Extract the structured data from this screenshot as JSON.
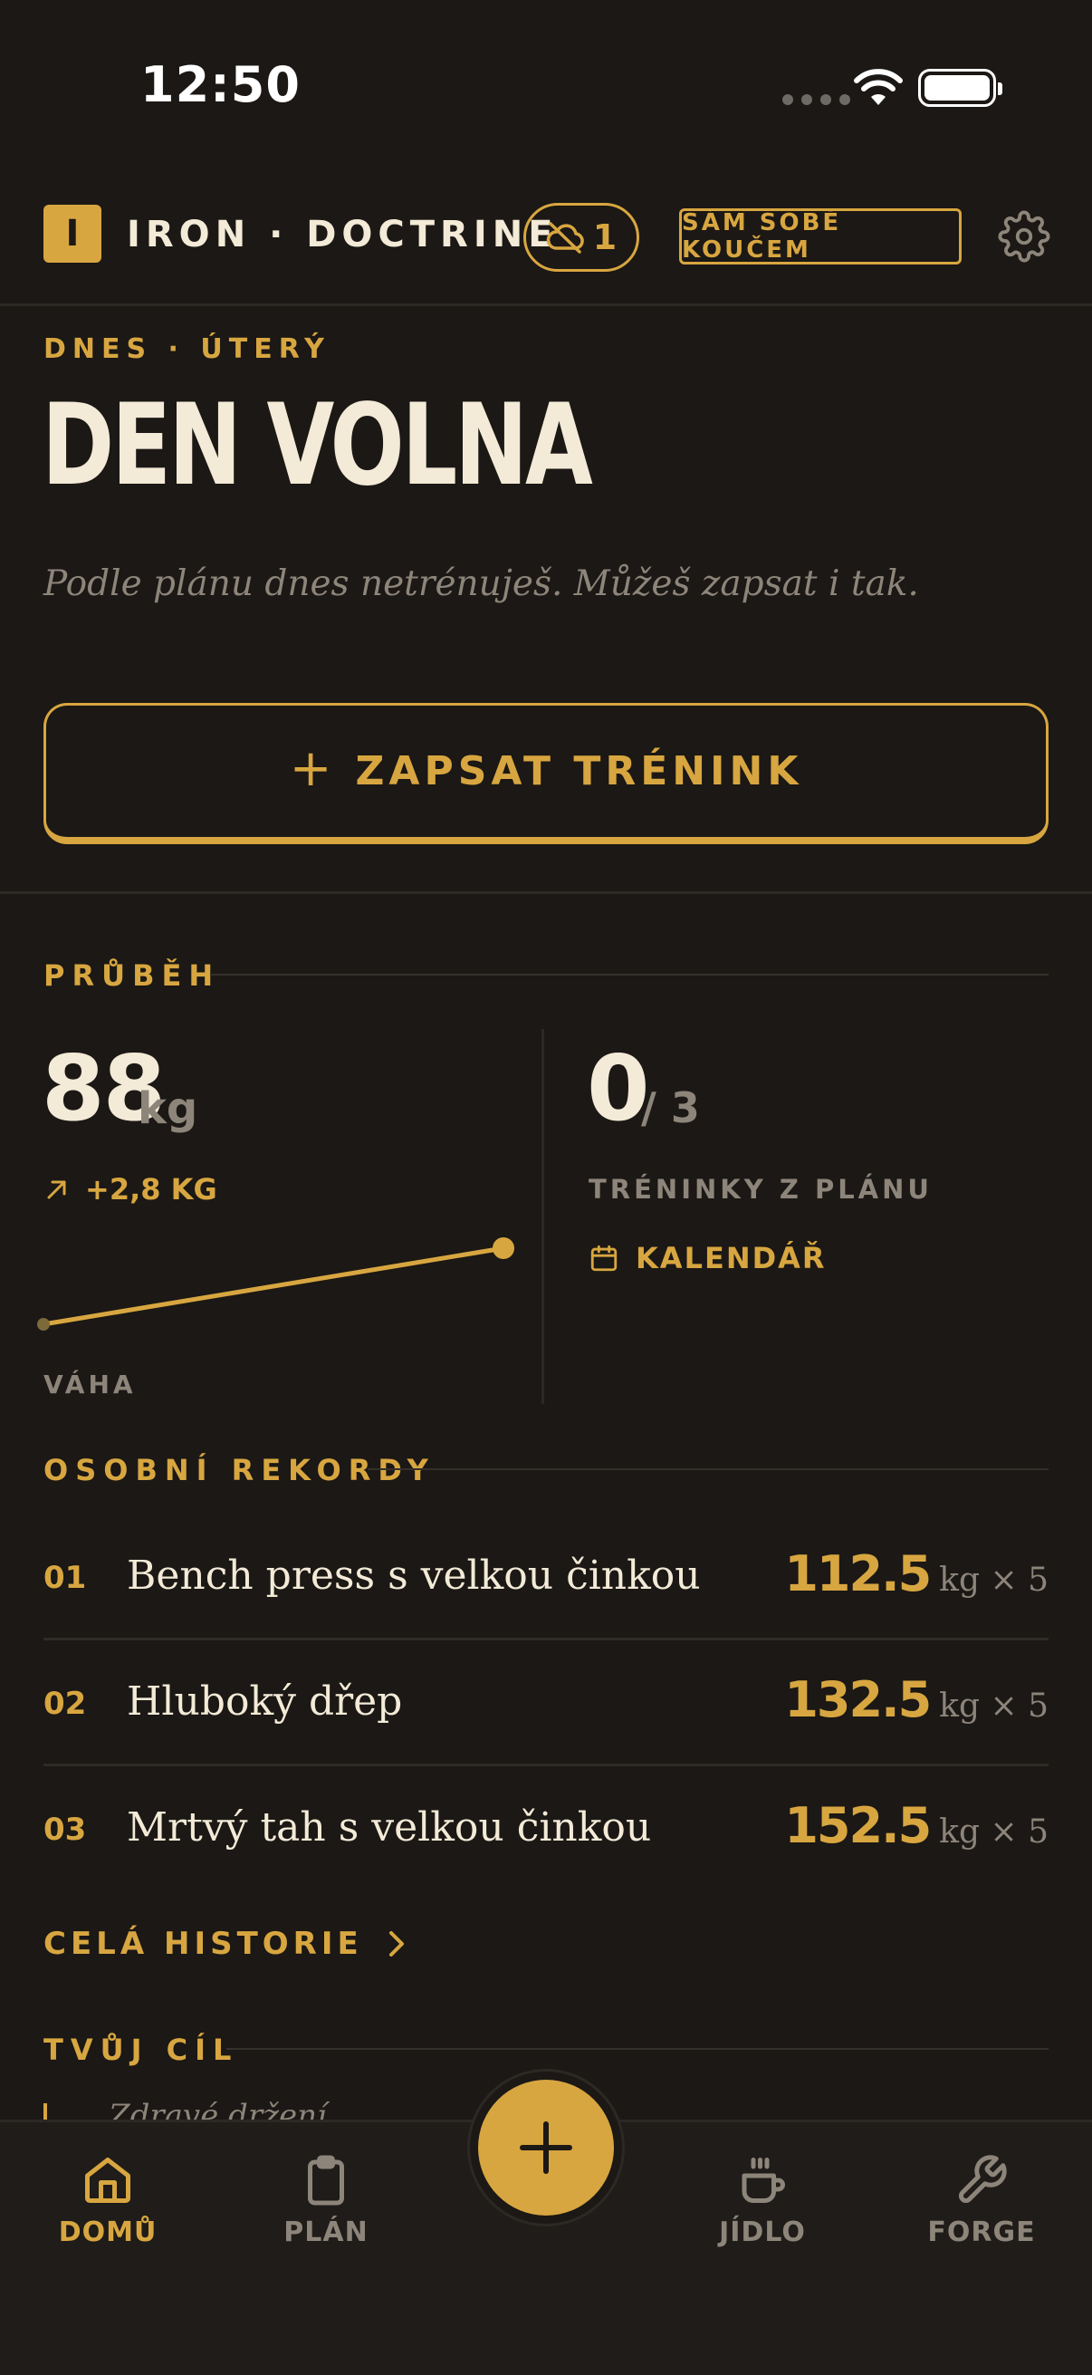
{
  "status_bar": {
    "time": "12:50"
  },
  "header": {
    "logo_letter": "I",
    "app_name": "IRON · DOCTRINE",
    "offline_count": "1",
    "coach_mode": "SÁM SOBĚ KOUČEM"
  },
  "today": {
    "label": "DNES · ÚTERÝ",
    "title": "DEN VOLNA",
    "subtitle": "Podle plánu dnes netrénuješ. Můžeš zapsat i tak.",
    "log_button": "ZAPSAT TRÉNINK"
  },
  "progress": {
    "heading": "PRŮBĚH",
    "weight": {
      "value": "88",
      "unit": "kg",
      "delta": "+2,8 KG",
      "label": "VÁHA"
    },
    "plan": {
      "done": "0",
      "total": "/ 3",
      "label": "TRÉNINKY Z PLÁNU",
      "calendar_link": "KALENDÁŘ"
    }
  },
  "records": {
    "heading": "OSOBNÍ REKORDY",
    "items": [
      {
        "num": "01",
        "name": "Bench press s velkou činkou",
        "weight": "112.5",
        "unit": "kg × 5"
      },
      {
        "num": "02",
        "name": "Hluboký dřep",
        "weight": "132.5",
        "unit": "kg × 5"
      },
      {
        "num": "03",
        "name": "Mrtvý tah s velkou činkou",
        "weight": "152.5",
        "unit": "kg × 5"
      }
    ],
    "history_link": "CELÁ HISTORIE"
  },
  "goal": {
    "heading": "TVŮJ CÍL",
    "peek_text": "Zdravé držení"
  },
  "nav": {
    "home": "DOMŮ",
    "plan": "PLÁN",
    "food": "JÍDLO",
    "forge": "FORGE"
  },
  "colors": {
    "accent": "#d8a640",
    "background": "#1b1815",
    "text": "#f3ead7",
    "muted": "#8d857a"
  },
  "icons": [
    "wifi-icon",
    "battery-icon",
    "cloud-off-icon",
    "gear-icon",
    "plus-icon",
    "trend-up-icon",
    "calendar-icon",
    "chevron-right-icon",
    "home-icon",
    "clipboard-icon",
    "cup-icon",
    "wrench-icon"
  ]
}
